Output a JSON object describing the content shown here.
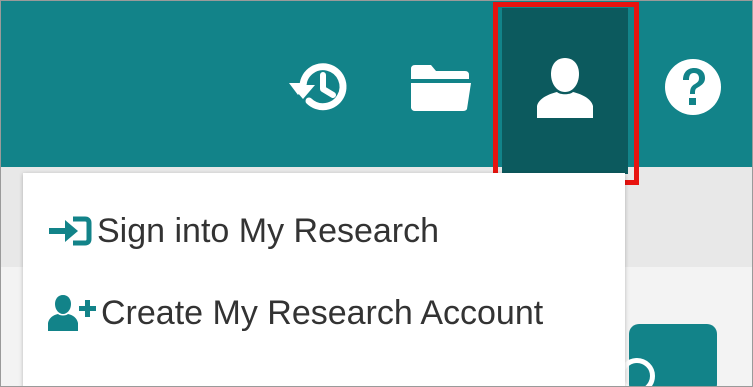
{
  "colors": {
    "topbar": "#128389",
    "active_button": "#0c5a5e",
    "highlight_box": "#e8130f",
    "menu_text": "#333333",
    "menu_icon": "#128389"
  },
  "toolbar": {
    "icons": [
      {
        "name": "history-icon"
      },
      {
        "name": "folder-icon"
      },
      {
        "name": "user-icon"
      },
      {
        "name": "help-icon"
      }
    ]
  },
  "account_menu": {
    "items": [
      {
        "label": "Sign into My Research",
        "icon": "sign-in-icon"
      },
      {
        "label": "Create My Research Account",
        "icon": "user-plus-icon"
      }
    ]
  }
}
